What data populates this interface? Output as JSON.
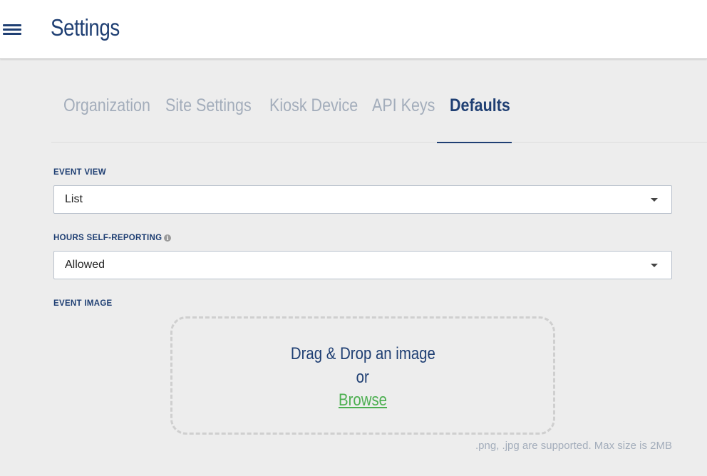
{
  "header": {
    "title": "Settings",
    "menu_icon": "hamburger-menu-icon"
  },
  "tabs": [
    {
      "label": "Organization",
      "active": false
    },
    {
      "label": "Site Settings",
      "active": false
    },
    {
      "label": "Kiosk Device",
      "active": false
    },
    {
      "label": "API Keys",
      "active": false
    },
    {
      "label": "Defaults",
      "active": true
    }
  ],
  "event_view": {
    "label": "EVENT VIEW",
    "value": "List"
  },
  "hours_self_reporting": {
    "label": "HOURS SELF-REPORTING",
    "info_icon": "i",
    "value": "Allowed"
  },
  "event_image": {
    "label": "EVENT IMAGE",
    "drop_text": "Drag & Drop an image",
    "or_text": "or",
    "browse_text": "Browse",
    "hint": ".png, .jpg are supported. Max size is 2MB"
  },
  "colors": {
    "primary": "#1f3f73",
    "muted": "#a3adbb",
    "browse": "#4caf50",
    "background": "#ededed"
  }
}
